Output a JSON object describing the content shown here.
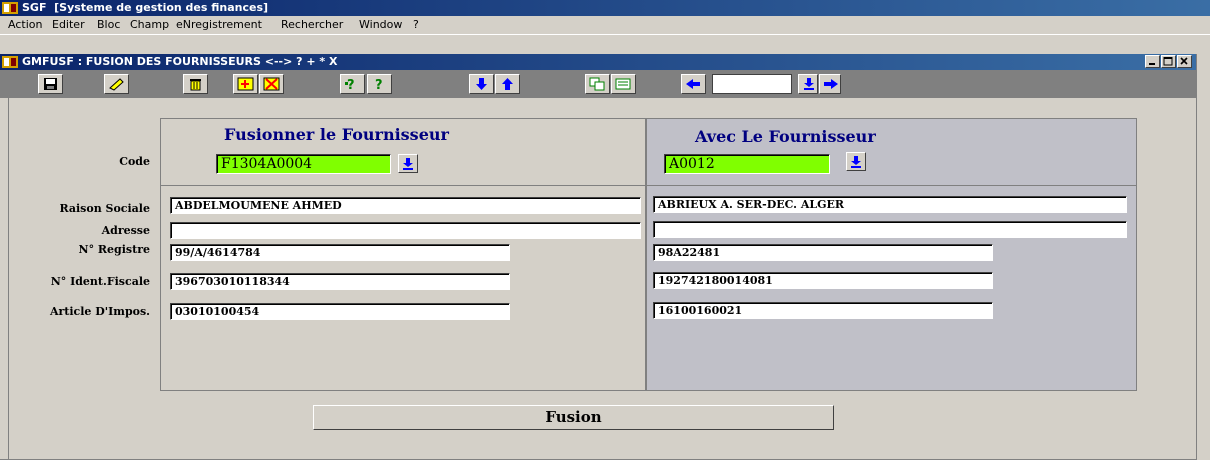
{
  "app": {
    "title": "SGF  [Systeme de gestion des finances]"
  },
  "menu": [
    "Action",
    "Editer",
    "Bloc",
    "Champ",
    "eNregistrement",
    "Rechercher",
    "Window",
    "?"
  ],
  "window": {
    "title": "GMFUSF : FUSION DES FOURNISSEURS <--> ? + * X"
  },
  "toolbar": {
    "buttons": [
      "save-icon",
      "clear-icon",
      "delete-icon",
      "insert-record-icon",
      "remove-record-icon",
      "query-icon",
      "help-icon",
      "next-block-icon",
      "previous-block-icon",
      "duplicate-icon",
      "list-icon",
      "previous-record-icon",
      "next-record-icon"
    ],
    "goto_value": ""
  },
  "colors": {
    "title_bar": "#0a246a",
    "heading": "#000080",
    "code_field": "#80ff00",
    "right_panel": "#c0c0c8"
  },
  "form": {
    "left_header": "Fusionner  le Fournisseur",
    "right_header": "Avec  Le Fournisseur",
    "labels": {
      "code": "Code",
      "raison_sociale": "Raison Sociale",
      "adresse": "Adresse",
      "registre": "N° Registre",
      "ident_fiscale": "N° Ident.Fiscale",
      "article": "Article D'Impos."
    },
    "left": {
      "code": "F1304A0004",
      "raison_sociale": "ABDELMOUMENE AHMED",
      "adresse": "",
      "registre": "99/A/4614784",
      "ident_fiscale": "396703010118344",
      "article": "03010100454"
    },
    "right": {
      "code": "A0012",
      "raison_sociale": "ABRIEUX A. SER-DEC. ALGER",
      "adresse": "",
      "registre": "98A22481",
      "ident_fiscale": "192742180014081",
      "article": "16100160021"
    },
    "fusion_button": "Fusion"
  }
}
